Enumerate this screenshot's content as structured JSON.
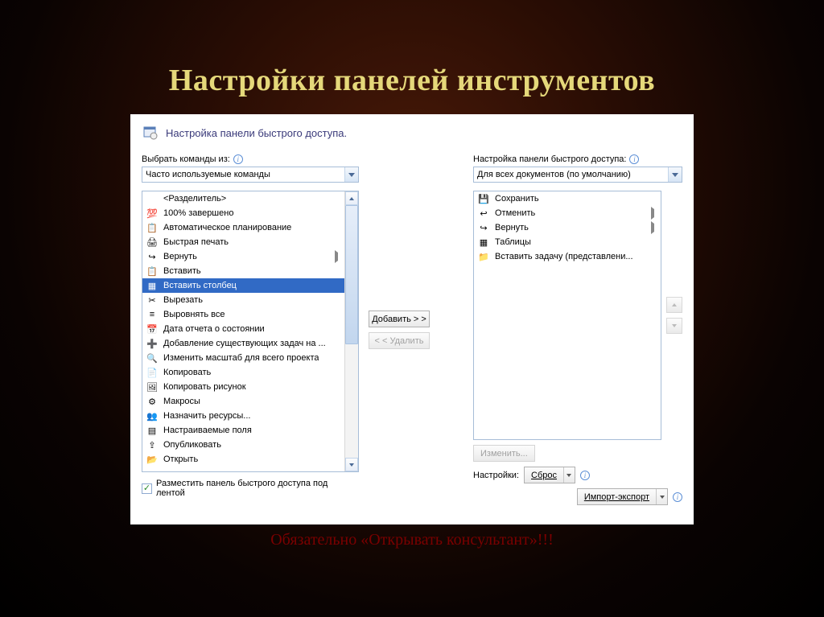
{
  "slide": {
    "title": "Настройки панелей инструментов",
    "footer": "Обязательно «Открывать консультант»!!!"
  },
  "dialog": {
    "header": "Настройка панели быстрого доступа.",
    "left_label": "Выбрать команды из:",
    "left_dropdown": "Часто используемые команды",
    "right_label": "Настройка панели быстрого доступа:",
    "right_dropdown": "Для всех документов (по умолчанию)",
    "add_button": "Добавить > >",
    "remove_button": "< < Удалить",
    "modify_button": "Изменить...",
    "settings_label": "Настройки:",
    "reset_button": "Сброс",
    "import_export_button": "Импорт-экспорт",
    "checkbox_label": "Разместить панель быстрого доступа под лентой",
    "checkbox_checked": true
  },
  "left_list": [
    {
      "label": "<Разделитель>",
      "icon": "separator"
    },
    {
      "label": "100% завершено",
      "icon": "percent"
    },
    {
      "label": "Автоматическое планирование",
      "icon": "auto-plan"
    },
    {
      "label": "Быстрая печать",
      "icon": "print"
    },
    {
      "label": "Вернуть",
      "icon": "redo",
      "flyout": true
    },
    {
      "label": "Вставить",
      "icon": "paste"
    },
    {
      "label": "Вставить столбец",
      "icon": "insert-column",
      "selected": true
    },
    {
      "label": "Вырезать",
      "icon": "cut"
    },
    {
      "label": "Выровнять все",
      "icon": "align"
    },
    {
      "label": "Дата отчета о состоянии",
      "icon": "date"
    },
    {
      "label": "Добавление существующих задач на ...",
      "icon": "add-task"
    },
    {
      "label": "Изменить масштаб для всего проекта",
      "icon": "zoom"
    },
    {
      "label": "Копировать",
      "icon": "copy"
    },
    {
      "label": "Копировать рисунок",
      "icon": "copy-picture"
    },
    {
      "label": "Макросы",
      "icon": "macros"
    },
    {
      "label": "Назначить ресурсы...",
      "icon": "assign"
    },
    {
      "label": "Настраиваемые поля",
      "icon": "fields"
    },
    {
      "label": "Опубликовать",
      "icon": "publish"
    },
    {
      "label": "Открыть",
      "icon": "open"
    }
  ],
  "right_list": [
    {
      "label": "Сохранить",
      "icon": "save"
    },
    {
      "label": "Отменить",
      "icon": "undo",
      "flyout": true
    },
    {
      "label": "Вернуть",
      "icon": "redo",
      "flyout": true
    },
    {
      "label": "Таблицы",
      "icon": "tables"
    },
    {
      "label": "Вставить задачу (представлени...",
      "icon": "insert-task"
    }
  ],
  "icon_glyphs": {
    "separator": " ",
    "percent": "💯",
    "auto-plan": "📋",
    "print": "🖨",
    "redo": "↪",
    "paste": "📋",
    "insert-column": "▦",
    "cut": "✂",
    "align": "≡",
    "date": "📅",
    "add-task": "➕",
    "zoom": "🔍",
    "copy": "📄",
    "copy-picture": "🖼",
    "macros": "⚙",
    "assign": "👥",
    "fields": "▤",
    "publish": "⇪",
    "open": "📂",
    "save": "💾",
    "undo": "↩",
    "tables": "▦",
    "insert-task": "📁"
  }
}
